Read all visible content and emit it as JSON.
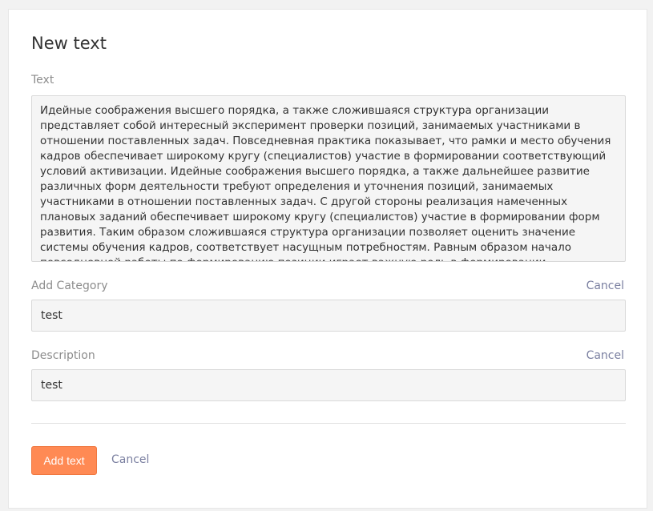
{
  "form": {
    "title": "New text",
    "text_field": {
      "label": "Text",
      "value": "Идейные соображения высшего порядка, а также сложившаяся структура организации представляет собой интересный эксперимент проверки позиций, занимаемых участниками в отношении поставленных задач. Повседневная практика показывает, что рамки и место обучения кадров обеспечивает широкому кругу (специалистов) участие в формировании соответствующий условий активизации. Идейные соображения высшего порядка, а также дальнейшее развитие различных форм деятельности требуют определения и уточнения позиций, занимаемых участниками в отношении поставленных задач. С другой стороны реализация намеченных плановых заданий обеспечивает широкому кругу (специалистов) участие в формировании форм развития. Таким образом сложившаяся структура организации позволяет оценить значение системы обучения кадров, соответствует насущным потребностям. Равным образом начало повседневной работы по формированию позиции играет важную роль в формировании существенных финансовых и административных условий."
    },
    "category_field": {
      "label": "Add Category",
      "cancel_label": "Cancel",
      "value": "test"
    },
    "description_field": {
      "label": "Description",
      "cancel_label": "Cancel",
      "value": "test"
    },
    "actions": {
      "submit_label": "Add text",
      "cancel_label": "Cancel"
    }
  },
  "colors": {
    "accent": "#ff8a54",
    "link": "#7a7fa0"
  }
}
